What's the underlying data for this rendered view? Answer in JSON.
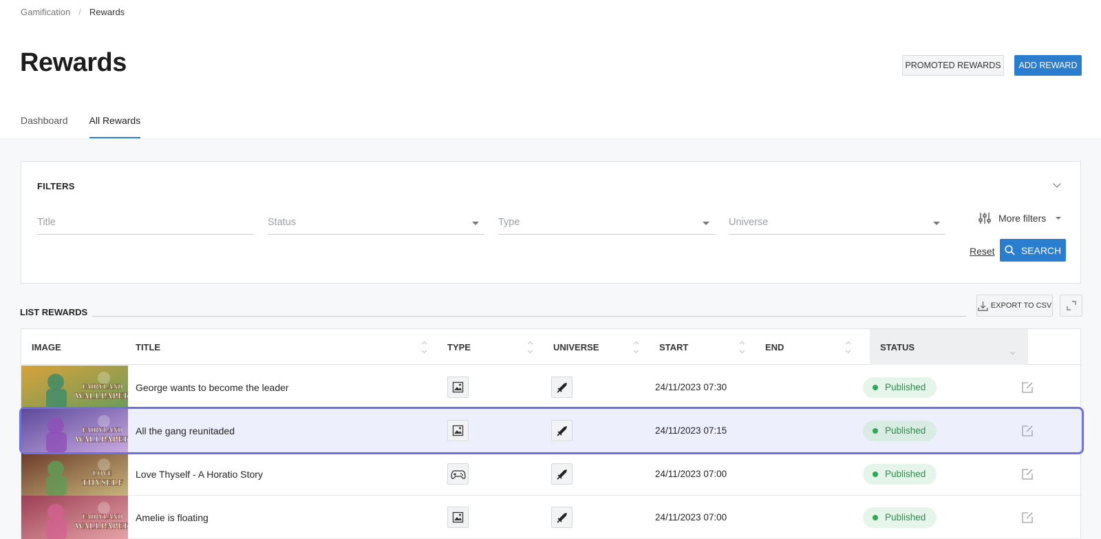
{
  "breadcrumb": {
    "parent": "Gamification",
    "separator": "/",
    "current": "Rewards"
  },
  "page": {
    "title": "Rewards"
  },
  "actions": {
    "promoted_label": "PROMOTED REWARDS",
    "add_label": "ADD REWARD"
  },
  "tabs": [
    {
      "label": "Dashboard",
      "active": false
    },
    {
      "label": "All Rewards",
      "active": true
    }
  ],
  "filters": {
    "title": "FILTERS",
    "title_placeholder": "Title",
    "status_placeholder": "Status",
    "type_placeholder": "Type",
    "universe_placeholder": "Universe",
    "more_filters_label": "More filters",
    "reset_label": "Reset",
    "search_label": "SEARCH"
  },
  "list": {
    "label": "LIST REWARDS",
    "export_label": "EXPORT TO CSV",
    "columns": [
      "IMAGE",
      "TITLE",
      "TYPE",
      "UNIVERSE",
      "START",
      "END",
      "STATUS"
    ],
    "rows": [
      {
        "title": "George wants to become the leader",
        "type_icon": "wallpaper-icon",
        "universe_icon": "sword-icon",
        "start": "24/11/2023 07:30",
        "end": "",
        "status": "Published",
        "thumb_text": "FAIRYLAND WALLPAPER"
      },
      {
        "title": "All the gang reunitaded",
        "type_icon": "wallpaper-icon",
        "universe_icon": "sword-icon",
        "start": "24/11/2023 07:15",
        "end": "",
        "status": "Published",
        "thumb_text": "FAIRYLAND WALLPAPER",
        "selected": true
      },
      {
        "title": "Love Thyself - A Horatio Story",
        "type_icon": "gamepad-icon",
        "universe_icon": "sword-icon",
        "start": "24/11/2023 07:00",
        "end": "",
        "status": "Published",
        "thumb_text": "LOVE THYSELF"
      },
      {
        "title": "Amelie is floating",
        "type_icon": "wallpaper-icon",
        "universe_icon": "sword-icon",
        "start": "24/11/2023 07:00",
        "end": "",
        "status": "Published",
        "thumb_text": "FAIRYLAND WALLPAPER"
      }
    ]
  },
  "colors": {
    "accent": "#2b7dcf",
    "selection": "#6d6fe3",
    "published": "#2ea85a"
  }
}
